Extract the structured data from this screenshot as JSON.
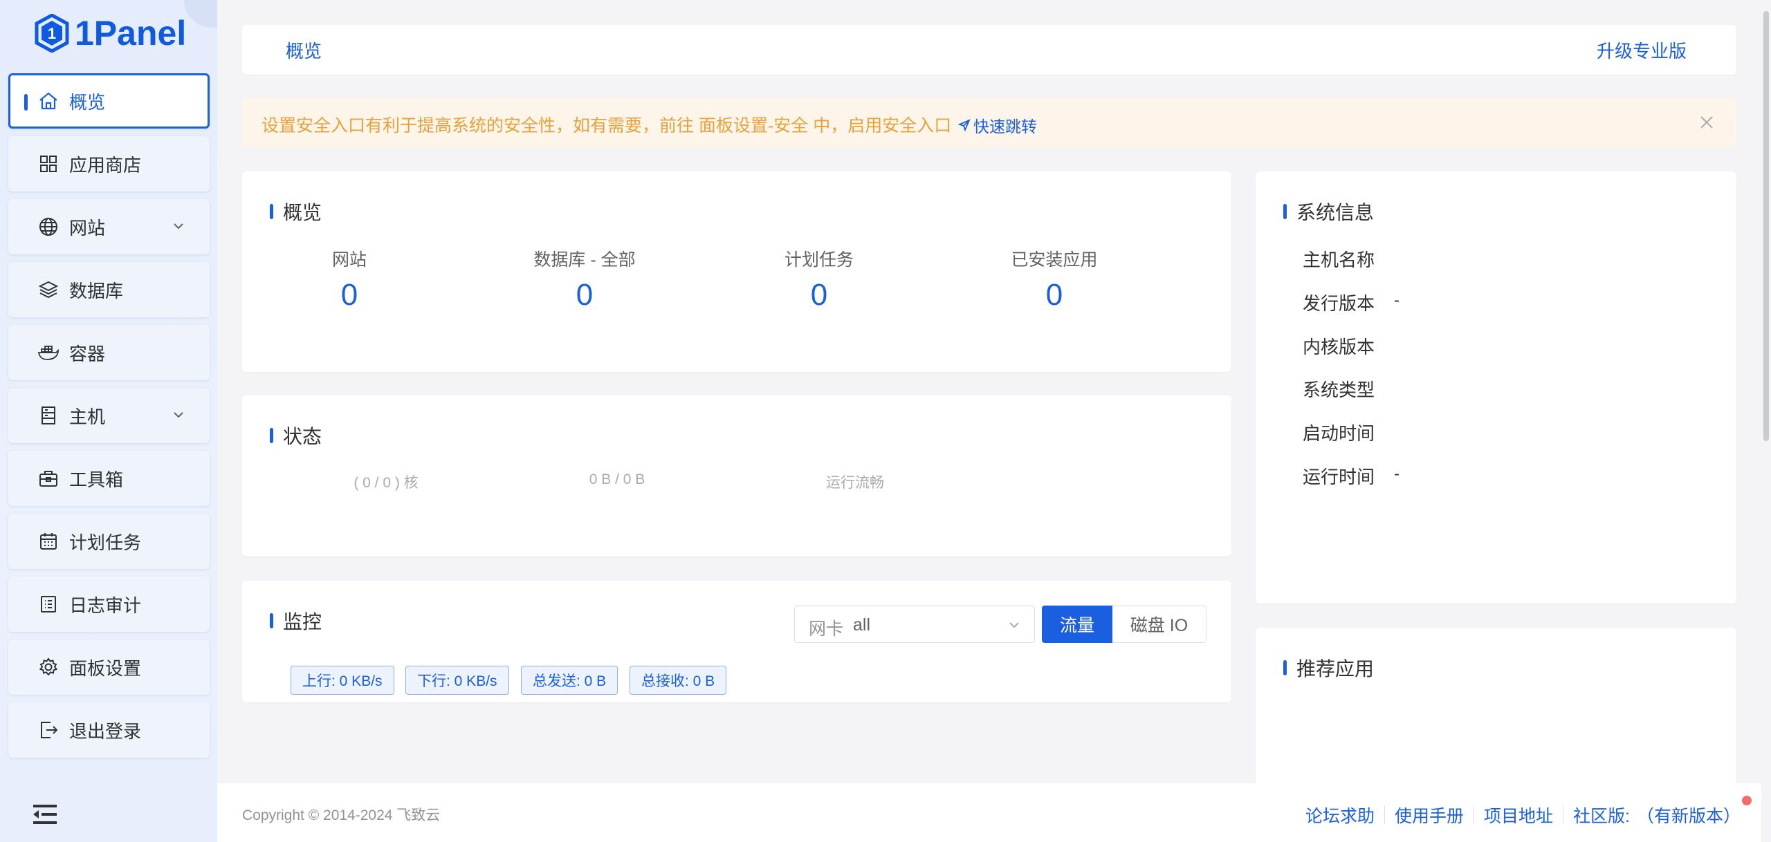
{
  "brand": {
    "name": "1Panel",
    "color": "#1a5fe0"
  },
  "sidebar": {
    "items": [
      {
        "label": "概览",
        "icon": "home-icon",
        "active": true
      },
      {
        "label": "应用商店",
        "icon": "app-grid-icon"
      },
      {
        "label": "网站",
        "icon": "globe-icon",
        "expandable": true
      },
      {
        "label": "数据库",
        "icon": "database-layers-icon"
      },
      {
        "label": "容器",
        "icon": "docker-icon"
      },
      {
        "label": "主机",
        "icon": "server-icon",
        "expandable": true
      },
      {
        "label": "工具箱",
        "icon": "toolbox-icon"
      },
      {
        "label": "计划任务",
        "icon": "calendar-icon"
      },
      {
        "label": "日志审计",
        "icon": "log-icon"
      },
      {
        "label": "面板设置",
        "icon": "gear-icon"
      },
      {
        "label": "退出登录",
        "icon": "logout-icon"
      }
    ]
  },
  "header": {
    "tab": "概览",
    "upgrade": "升级专业版"
  },
  "alert": {
    "message": "设置安全入口有利于提高系统的安全性，如有需要，前往 面板设置-安全 中，启用安全入口",
    "link": "快速跳转"
  },
  "overview": {
    "title": "概览",
    "stats": [
      {
        "label": "网站",
        "value": "0"
      },
      {
        "label": "数据库 - 全部",
        "value": "0"
      },
      {
        "label": "计划任务",
        "value": "0"
      },
      {
        "label": "已安装应用",
        "value": "0"
      }
    ]
  },
  "status": {
    "title": "状态",
    "items": [
      "( 0 / 0 ) 核",
      "0 B / 0 B",
      "运行流畅"
    ]
  },
  "monitor": {
    "title": "监控",
    "nic_prefix": "网卡",
    "nic_value": "all",
    "toggle": [
      "流量",
      "磁盘 IO"
    ],
    "tags": [
      "上行: 0 KB/s",
      "下行: 0 KB/s",
      "总发送: 0 B",
      "总接收: 0 B"
    ]
  },
  "sysinfo": {
    "title": "系统信息",
    "rows": [
      {
        "label": "主机名称",
        "value": ""
      },
      {
        "label": "发行版本",
        "value": "-"
      },
      {
        "label": "内核版本",
        "value": ""
      },
      {
        "label": "系统类型",
        "value": ""
      },
      {
        "label": "启动时间",
        "value": ""
      },
      {
        "label": "运行时间",
        "value": "-"
      }
    ]
  },
  "recommend": {
    "title": "推荐应用"
  },
  "footer": {
    "copyright": "Copyright © 2014-2024 飞致云",
    "links": [
      "论坛求助",
      "使用手册",
      "项目地址"
    ],
    "edition": "社区版:",
    "update": "（有新版本）"
  }
}
